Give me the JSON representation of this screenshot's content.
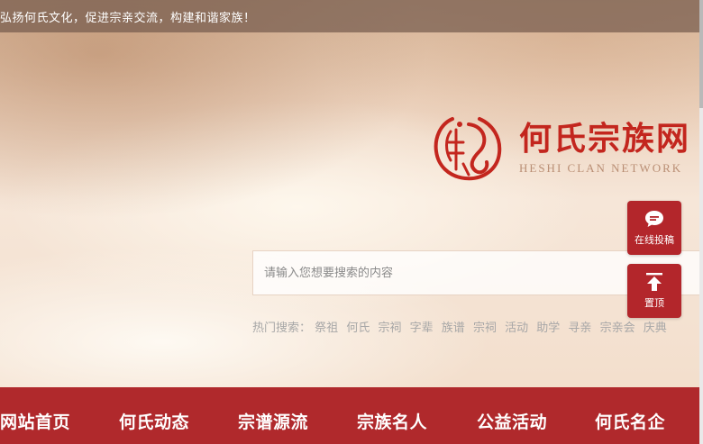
{
  "topbar": {
    "slogan": "弘扬何氏文化，促进宗亲交流，构建和谐家族！"
  },
  "brand": {
    "name": "何氏宗族网",
    "name_en": "HESHI CLAN NETWORK",
    "logo_icon": "seal-logo-icon",
    "color": "#c3261e"
  },
  "search": {
    "value": "",
    "placeholder": "请输入您想要搜索的内容"
  },
  "hot_search": {
    "label": "热门搜索：",
    "keywords": [
      "祭祖",
      "何氏",
      "宗祠",
      "字辈",
      "族谱",
      "宗祠",
      "活动",
      "助学",
      "寻亲",
      "宗亲会",
      "庆典"
    ]
  },
  "float_buttons": {
    "submit_label": "在线投稿",
    "submit_icon": "chat-bubble-icon",
    "top_label": "置顶",
    "top_icon": "arrow-up-icon"
  },
  "nav": {
    "items": [
      "网站首页",
      "何氏动态",
      "宗谱源流",
      "宗族名人",
      "公益活动",
      "何氏名企"
    ],
    "background": "#b0292c"
  }
}
